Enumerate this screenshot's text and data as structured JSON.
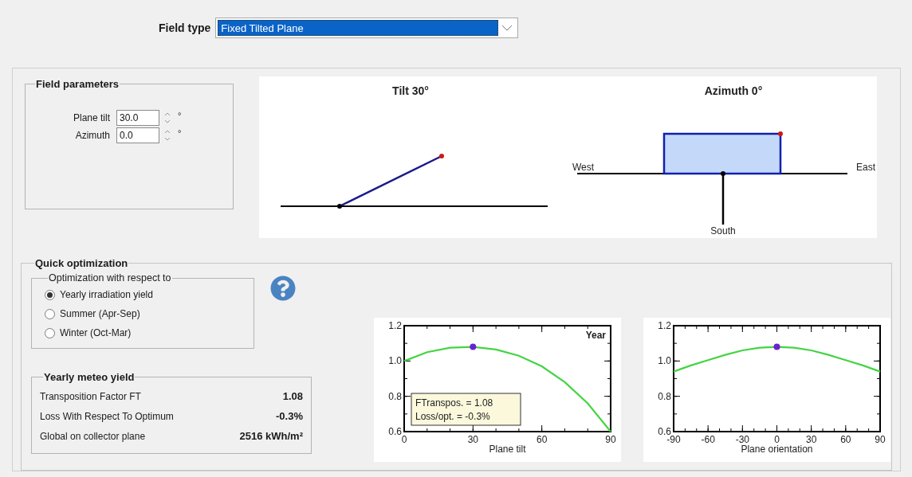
{
  "field_type": {
    "label": "Field type",
    "value": "Fixed Tilted Plane"
  },
  "field_parameters": {
    "title": "Field parameters",
    "fields": [
      {
        "label": "Plane tilt",
        "value": "30.0",
        "unit": "°"
      },
      {
        "label": "Azimuth",
        "value": "0.0",
        "unit": "°"
      }
    ]
  },
  "diagrams": {
    "tilt": {
      "title": "Tilt 30°"
    },
    "azimuth": {
      "title": "Azimuth 0°",
      "west": "West",
      "east": "East",
      "south": "South"
    }
  },
  "quick_optimization": {
    "title": "Quick optimization",
    "criterion": {
      "title": "Optimization with respect to",
      "options": [
        {
          "label": "Yearly irradiation yield",
          "selected": true
        },
        {
          "label": "Summer (Apr-Sep)",
          "selected": false
        },
        {
          "label": "Winter (Oct-Mar)",
          "selected": false
        }
      ]
    },
    "meteo_yield": {
      "title": "Yearly meteo yield",
      "rows": [
        {
          "label": "Transposition Factor FT",
          "value": "1.08"
        },
        {
          "label": "Loss With Respect To Optimum",
          "value": "-0.3%"
        },
        {
          "label": "Global on collector plane",
          "value": "2516 kWh/m²"
        }
      ]
    },
    "charts": [
      {
        "note": [
          "FTranspos. = 1.08",
          "Loss/opt. = -0.3%"
        ],
        "chart_data": {
          "type": "line",
          "title": "Year",
          "xlabel": "Plane tilt",
          "x": [
            0,
            10,
            20,
            30,
            40,
            50,
            60,
            70,
            80,
            90
          ],
          "series": [
            {
              "color": "#44d444",
              "values": [
                1.0,
                1.05,
                1.075,
                1.08,
                1.065,
                1.03,
                0.97,
                0.88,
                0.76,
                0.6
              ]
            }
          ],
          "xlim": [
            0,
            90
          ],
          "ylim": [
            0.6,
            1.2
          ],
          "xticks": [
            0,
            30,
            60,
            90
          ],
          "yticks": [
            0.6,
            0.8,
            {
              "value": 1,
              "label": "1.0"
            },
            1.2
          ]
        }
      },
      {
        "chart_data": {
          "type": "line",
          "xlabel": "Plane orientation",
          "x": [
            -90,
            -75,
            -60,
            -45,
            -30,
            -15,
            0,
            15,
            30,
            45,
            60,
            75,
            90
          ],
          "series": [
            {
              "color": "#44d444",
              "values": [
                0.94,
                0.975,
                1.005,
                1.035,
                1.06,
                1.075,
                1.08,
                1.075,
                1.06,
                1.035,
                1.005,
                0.975,
                0.94
              ]
            }
          ],
          "xlim": [
            -90,
            90
          ],
          "ylim": [
            0.6,
            1.2
          ],
          "xticks": [
            -90,
            -60,
            -30,
            0,
            30,
            60,
            90
          ],
          "yticks": [
            0.6,
            0.8,
            {
              "value": 1,
              "label": "1.0"
            },
            1.2
          ]
        }
      }
    ]
  }
}
